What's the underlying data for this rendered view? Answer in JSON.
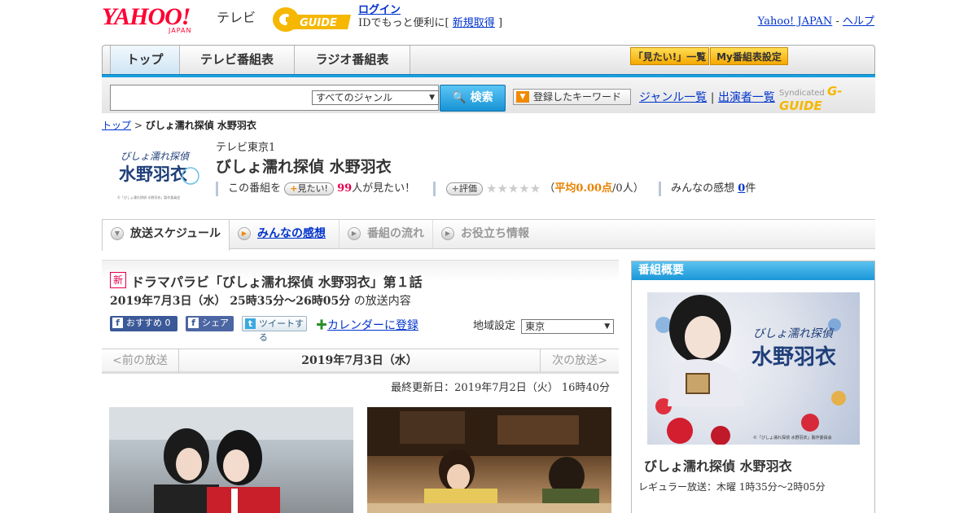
{
  "header": {
    "logo_text": "YAHOO!",
    "logo_sub": "JAPAN",
    "section": "テレビ",
    "gguide_logo": "G-GUIDE",
    "login_label": "ログイン",
    "login_prompt_prefix": "IDでもっと便利に[",
    "signup_label": "新規取得",
    "login_prompt_suffix": "]",
    "yahoo_japan_link": "Yahoo! JAPAN",
    "separator": "-",
    "help_link": "ヘルプ"
  },
  "nav": {
    "tabs": [
      {
        "label": "トップ"
      },
      {
        "label": "テレビ番組表"
      },
      {
        "label": "ラジオ番組表"
      }
    ],
    "mitai_list": "「見たい!」一覧",
    "my_schedule": "My番組表設定"
  },
  "search": {
    "query": "",
    "genre_selected": "すべてのジャンル",
    "search_button": "検索",
    "keyword_button": "登録したキーワード",
    "genre_list": "ジャンル一覧",
    "divider": "|",
    "cast_list": "出演者一覧",
    "syndicated": "Syndicated",
    "syndicated_logo": "G-GUIDE"
  },
  "breadcrumb": {
    "top": "トップ",
    "separator": ">",
    "current": "びしょ濡れ探偵 水野羽衣"
  },
  "program": {
    "channel": "テレビ東京1",
    "title": "びしょ濡れ探偵 水野羽衣",
    "logo_line1": "びしょ濡れ探偵",
    "logo_line2": "水野羽衣",
    "logo_credit": "©「びしょ濡れ探偵 水野羽衣」製作委員会",
    "this_program": "この番組を",
    "mitai_button": "見たい!",
    "mitai_count": "99",
    "mitai_suffix": "人が見たい！",
    "rating_button": "評価",
    "stars": "★★★★★",
    "avg_open": "（",
    "avg_label": "平均0.00点",
    "avg_people": "/0人）",
    "impressions_label": "みんなの感想",
    "impressions_count": "0",
    "impressions_suffix": "件"
  },
  "tabs": [
    {
      "label": "放送スケジュール"
    },
    {
      "label": "みんなの感想"
    },
    {
      "label": "番組の流れ"
    },
    {
      "label": "お役立ち情報"
    }
  ],
  "episode": {
    "new_badge": "新",
    "title": "ドラマパラビ「びしょ濡れ探偵 水野羽衣」第１話",
    "datetime": "2019年7月3日（水） 25時35分～26時05分",
    "datetime_suffix": "の放送内容",
    "recommend": "おすすめ 0",
    "share": "シェア",
    "tweet": "ツイートする",
    "calendar": "カレンダーに登録",
    "region_label": "地域設定",
    "region_value": "東京"
  },
  "date_nav": {
    "prev": "<前の放送",
    "current": "2019年7月3日（水）",
    "next": "次の放送>"
  },
  "updated": "最終更新日：2019年7月2日（火） 16時40分",
  "sidebar": {
    "heading": "番組概要",
    "image_title_line1": "びしょ濡れ探偵",
    "image_title_line2": "水野羽衣",
    "image_credit": "©「びしょ濡れ探偵 水野羽衣」製作委員会",
    "title": "びしょ濡れ探偵 水野羽衣",
    "regular": "レギュラー放送：木曜 1時35分～2時05分"
  },
  "colors": {
    "brand_red": "#ff0033",
    "accent_blue": "#1aa0e0",
    "link": "#0033cc",
    "count_red": "#e4004f",
    "rating_orange": "#e88200",
    "gguide_yellow": "#f5b700"
  }
}
